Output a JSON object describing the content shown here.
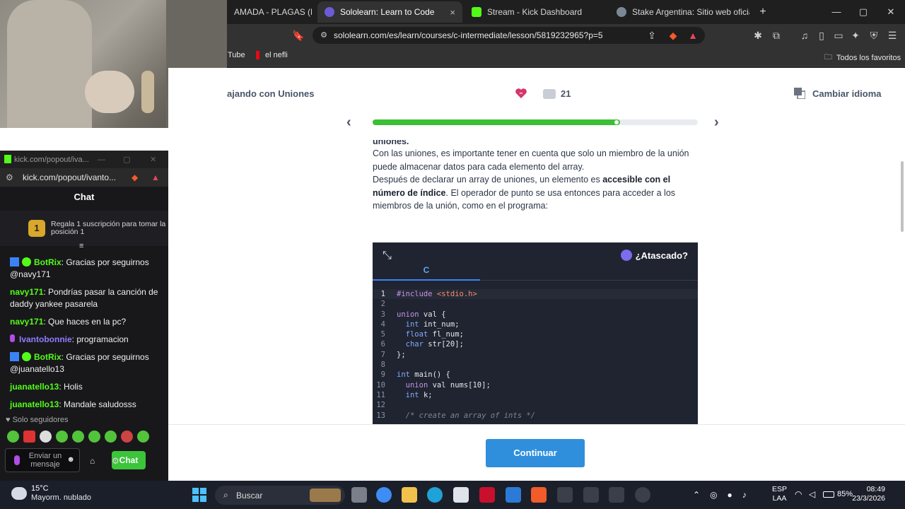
{
  "browser": {
    "tabs": [
      {
        "label": "AMADA - PLAGAS (FULL A",
        "active": false
      },
      {
        "label": "Sololearn: Learn to Code",
        "active": true
      },
      {
        "label": "Stream - Kick Dashboard",
        "active": false
      },
      {
        "label": "Stake Argentina: Sitio web oficial de",
        "active": false
      }
    ],
    "url": "sololearn.com/es/learn/courses/c-intermediate/lesson/5819232965?p=5",
    "bookmarks": [
      "Tube",
      "el nefli"
    ],
    "bookmarks_folder": "Todos los favoritos",
    "new_tab": "+",
    "close_tab": "×",
    "brave_count": "4"
  },
  "chat_window": {
    "title": "kick.com/popout/iva...",
    "url": "kick.com/popout/ivanto...",
    "brave_count": "3",
    "heading": "Chat",
    "promo_badge": "1",
    "promo_text": "Regala 1 suscripción para tomar la posición 1",
    "messages": [
      {
        "user": "BotRix",
        "text": ": Gracias por seguirnos @navy171",
        "color": "#53fc18",
        "verified": true
      },
      {
        "user": "navy171",
        "text": ": Pondrías pasar la canción de daddy yankee pasarela",
        "color": "#53fc18",
        "verified": false
      },
      {
        "user": "navy171",
        "text": ": Que haces en la pc?",
        "color": "#53fc18",
        "verified": false
      },
      {
        "user": "Ivantobonnie",
        "text": ": programacion",
        "color": "#8f7cff",
        "verified": false
      },
      {
        "user": "BotRix",
        "text": ": Gracias por seguirnos @juanatello13",
        "color": "#53fc18",
        "verified": true
      },
      {
        "user": "juanatello13",
        "text": ": Holis",
        "color": "#53fc18",
        "verified": false
      },
      {
        "user": "juanatello13",
        "text": ": Mandale saludosss",
        "color": "#53fc18",
        "verified": false
      }
    ],
    "followers_only": "Solo seguidores",
    "input_placeholder": "Enviar un mensaje",
    "send_label": "Chat"
  },
  "lesson": {
    "title_fragment": "ajando con Uniones",
    "comments": "21",
    "change_language": "Cambiar idioma",
    "progress_fraction": 0.76,
    "text_cut": "uniones.",
    "p1": "Con las uniones, es importante tener en cuenta que solo un miembro de la unión puede almacenar datos para cada elemento del array.",
    "p2_a": "Después de declarar un array de uniones, un elemento es ",
    "p2_b": "accesible con el número de índice",
    "p2_c": ". El operador de punto se usa entonces para acceder a los miembros de la unión, como en el programa:",
    "stuck": "¿Atascado?",
    "code_tab": "C",
    "code_lines": [
      {
        "n": "1",
        "html": "<span class=\"pp\">#include</span> <span class=\"st\">&lt;stdio.h&gt;</span>"
      },
      {
        "n": "2",
        "html": ""
      },
      {
        "n": "3",
        "html": "<span class=\"kw\">union</span> val {"
      },
      {
        "n": "4",
        "html": "  <span class=\"ty\">int</span> int_num;"
      },
      {
        "n": "5",
        "html": "  <span class=\"ty\">float</span> fl_num;"
      },
      {
        "n": "6",
        "html": "  <span class=\"ty\">char</span> str[20];"
      },
      {
        "n": "7",
        "html": "};"
      },
      {
        "n": "8",
        "html": ""
      },
      {
        "n": "9",
        "html": "<span class=\"ty\">int</span> main() {"
      },
      {
        "n": "10",
        "html": "  <span class=\"kw\">union</span> val nums[10];"
      },
      {
        "n": "11",
        "html": "  <span class=\"ty\">int</span> k;"
      },
      {
        "n": "12",
        "html": ""
      },
      {
        "n": "13",
        "html": "  <span class=\"cm\">/* create an array of ints */</span>"
      }
    ],
    "continue": "Continuar"
  },
  "taskbar": {
    "temp": "15°C",
    "weather": "Mayorm. nublado",
    "search": "Buscar",
    "lang_1": "ESP",
    "lang_2": "LAA",
    "battery": "85%",
    "time": "08:49",
    "date": "23/3/2026"
  },
  "colors": {
    "accent_green": "#3bbf34",
    "continue_blue": "#2f8fdc",
    "kick_green": "#53fc18",
    "heart": "#d6336c"
  }
}
